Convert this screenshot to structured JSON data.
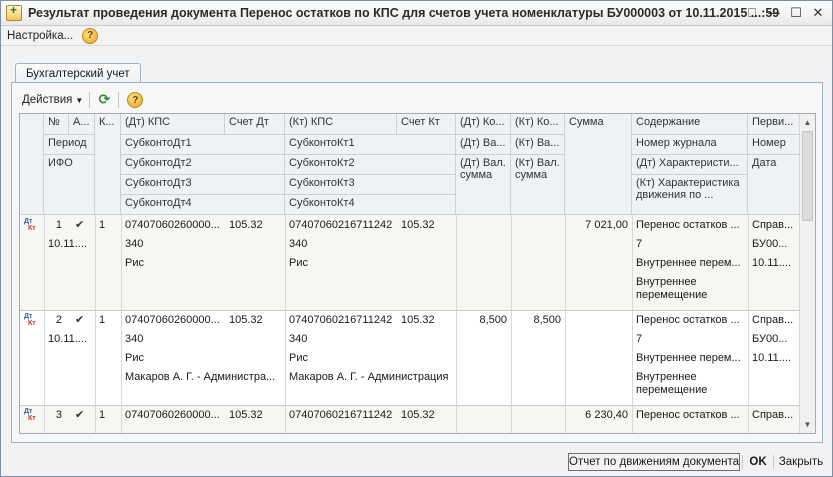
{
  "window": {
    "title": "Результат проведения документа Перенос остатков по КПС для счетов учета номенклатуры БУ000003 от 10.11.2015 ...:59",
    "controls": [
      "⎕",
      "—",
      "☐",
      "✕"
    ]
  },
  "menu": {
    "settings": "Настройка..."
  },
  "tab": {
    "label": "Бухгалтерский учет"
  },
  "toolbar": {
    "actions": "Действия"
  },
  "headers": {
    "num": "№",
    "a": "А...",
    "k": "К...",
    "dt_kps": "(Дт) КПС",
    "schet_dt": "Счет Дт",
    "kt_kps": "(Кт) КПС",
    "schet_kt": "Счет Кт",
    "dt_ko": "(Дт) Ко...",
    "kt_ko": "(Кт) Ко...",
    "summa": "Сумма",
    "content": "Содержание",
    "pervi": "Перви...",
    "period": "Период",
    "subdt1": "СубконтоДт1",
    "subkt1": "СубконтоКт1",
    "dt_va": "(Дт) Ва...",
    "kt_va": "(Кт) Ва...",
    "journal": "Номер журнала",
    "nomer": "Номер",
    "ifo": "ИФО",
    "subdt2": "СубконтоДт2",
    "subkt2": "СубконтоКт2",
    "dt_valsum": "(Дт) Вал. сумма",
    "kt_valsum": "(Кт) Вал. сумма",
    "dt_char": "(Дт) Характеристи...",
    "data": "Дата",
    "subdt3": "СубконтоДт3",
    "subkt3": "СубконтоКт3",
    "kt_char": "(Кт) Характеристика движения по ...",
    "subdt4": "СубконтоДт4",
    "subkt4": "СубконтоКт4"
  },
  "rows": [
    {
      "dt_label": "Дт",
      "kt_label": "Кт",
      "num": "1",
      "k": "1",
      "period": "10.11....",
      "dt_kps": "07407060260000...",
      "schet_dt": "105.32",
      "kt_kps": "07407060216711242",
      "schet_kt": "105.32",
      "dt_ko": "",
      "kt_ko": "",
      "summa": "7 021,00",
      "content": "Перенос остатков ...",
      "journal": "7",
      "dt_char": "Внутреннее перем...",
      "kt_char": "Внутреннее перемещение",
      "pervi": "Справ...",
      "nomer": "БУ00...",
      "data": "10.11....",
      "subdt1": "340",
      "subkt1": "340",
      "subdt2": "Рис",
      "subkt2": "Рис",
      "subdt3": "",
      "subkt3": ""
    },
    {
      "dt_label": "Дт",
      "kt_label": "Кт",
      "num": "2",
      "k": "1",
      "period": "10.11....",
      "dt_kps": "07407060260000...",
      "schet_dt": "105.32",
      "kt_kps": "07407060216711242",
      "schet_kt": "105.32",
      "dt_ko": "8,500",
      "kt_ko": "8,500",
      "summa": "",
      "content": "Перенос остатков ...",
      "journal": "7",
      "dt_char": "Внутреннее перем...",
      "kt_char": "Внутреннее перемещение",
      "pervi": "Справ...",
      "nomer": "БУ00...",
      "data": "10.11....",
      "subdt1": "340",
      "subkt1": "340",
      "subdt2": "Рис",
      "subkt2": "Рис",
      "subdt3": "Макаров А. Г. - Администра...",
      "subkt3": "Макаров А. Г. - Администрация"
    },
    {
      "dt_label": "Дт",
      "kt_label": "Кт",
      "num": "3",
      "k": "1",
      "dt_kps": "07407060260000...",
      "schet_dt": "105.32",
      "kt_kps": "07407060216711242",
      "schet_kt": "105.32",
      "summa": "6 230,40",
      "content": "Перенос остатков ...",
      "pervi": "Справ..."
    }
  ],
  "footer": {
    "report": "Отчет по движениям документа",
    "ok": "OK",
    "close": "Закрыть"
  }
}
